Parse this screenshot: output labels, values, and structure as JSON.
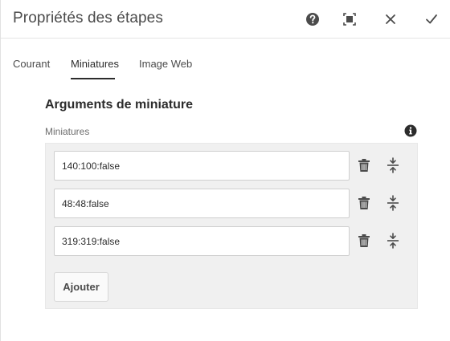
{
  "dialog": {
    "title": "Propriétés des étapes",
    "actions": {
      "help": "help-icon",
      "fullscreen": "fullscreen-icon",
      "close": "close-icon",
      "done": "checkmark-icon"
    }
  },
  "tabs": [
    {
      "label": "Courant",
      "selected": false
    },
    {
      "label": "Miniatures",
      "selected": true
    },
    {
      "label": "Image Web",
      "selected": false
    }
  ],
  "section": {
    "title": "Arguments de miniature",
    "field_label": "Miniatures",
    "info_icon": "info-icon"
  },
  "thumbnails": [
    {
      "value": "140:100:false"
    },
    {
      "value": "48:48:false"
    },
    {
      "value": "319:319:false"
    }
  ],
  "add_button": "Ajouter",
  "colors": {
    "text": "#2c2c2c",
    "muted": "#6e6e6e",
    "panel": "#f0f0f0",
    "icon": "#4b4b4b"
  }
}
